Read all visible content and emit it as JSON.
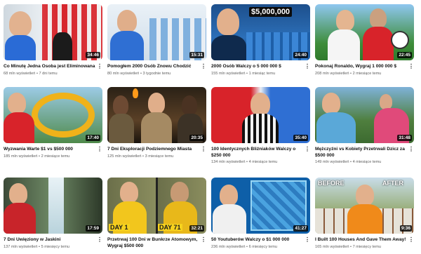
{
  "videos": [
    {
      "title": "Co Minutę Jedna Osoba jest Eliminowana",
      "meta": "68 mln wyświetleń • 7 dni temu",
      "duration": "34:46",
      "overlay": ""
    },
    {
      "title": "Pomogłem 2000 Osób Znowu Chodzić",
      "meta": "80 mln wyświetleń • 3 tygodnie temu",
      "duration": "15:31",
      "overlay": ""
    },
    {
      "title": "2000 Osób Walczy o 5 000 000 $",
      "meta": "155 mln wyświetleń • 1 miesiąc temu",
      "duration": "24:40",
      "overlay": "$5,000,000"
    },
    {
      "title": "Pokonaj Ronaldo, Wygraj 1 000 000 $",
      "meta": "208 mln wyświetleń • 2 miesiące temu",
      "duration": "22:45",
      "overlay": ""
    },
    {
      "title": "Wyzwania Warte $1 vs $500 000",
      "meta": "185 mln wyświetleń • 2 miesiące temu",
      "duration": "17:40",
      "overlay": ""
    },
    {
      "title": "7 Dni Eksploracji Podziemnego Miasta",
      "meta": "125 mln wyświetleń • 3 miesiące temu",
      "duration": "20:35",
      "overlay": ""
    },
    {
      "title": "100 Identycznych Bliźniaków Walczy o $250 000",
      "meta": "134 mln wyświetleń • 4 miesiące temu",
      "duration": "35:40",
      "overlay": ""
    },
    {
      "title": "Mężczyźni vs Kobiety Przetrwali Dzicz za $500 000",
      "meta": "149 mln wyświetleń • 4 miesiące temu",
      "duration": "31:48",
      "overlay": ""
    },
    {
      "title": "7 Dni Uwięziony w Jaskini",
      "meta": "137 mln wyświetleń • 5 miesięcy temu",
      "duration": "17:59",
      "overlay": ""
    },
    {
      "title": "Przetrwaj 100 Dni w Bunkrze Atomowym, Wygraj $500 000",
      "meta": "",
      "duration": "32:21",
      "overlay": "DAY 1",
      "overlay2": "DAY 71"
    },
    {
      "title": "50 Youtuberów Walczy o $1 000 000",
      "meta": "236 mln wyświetleń • 6 miesięcy temu",
      "duration": "41:27",
      "overlay": ""
    },
    {
      "title": "I Built 100 Houses And Gave Them Away!",
      "meta": "165 mln wyświetleń • 7 miesięcy temu",
      "duration": "9:36",
      "overlay": "BEFORE",
      "overlay2": "AFTER"
    }
  ],
  "icons": {
    "more": "more-vertical-icon"
  },
  "more_glyph": "⋮"
}
